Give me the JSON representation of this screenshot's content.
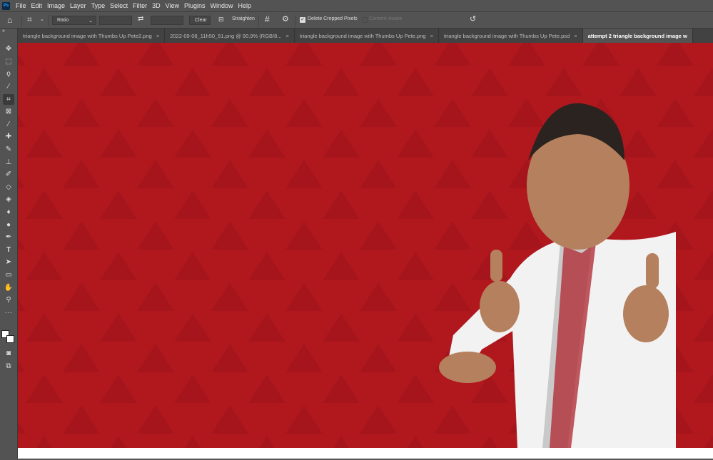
{
  "app": {
    "logo": "Ps"
  },
  "menu": [
    "File",
    "Edit",
    "Image",
    "Layer",
    "Type",
    "Select",
    "Filter",
    "3D",
    "View",
    "Plugins",
    "Window",
    "Help"
  ],
  "options": {
    "ratio": "Ratio",
    "clear": "Clear",
    "straighten": "Straighten",
    "delete_cropped": "Delete Cropped Pixels",
    "delete_cropped_checked": true,
    "content_aware": "Content-Aware",
    "content_aware_checked": false
  },
  "tabs": [
    {
      "label": "triangle background image with Thumbs Up Pete2.png",
      "active": false
    },
    {
      "label": "2022-09-08_11h50_51.png @ 90.9% (RGB/8...",
      "active": false
    },
    {
      "label": "triangle background image with Thumbs Up Pete.png",
      "active": false
    },
    {
      "label": "triangle background image with Thumbs Up Pete.psd",
      "active": false
    },
    {
      "label": "attempt 2 triangle background image w",
      "active": true
    }
  ],
  "tools": [
    "move",
    "marquee",
    "lasso",
    "magic-wand",
    "crop",
    "frame",
    "eyedropper",
    "healing",
    "brush",
    "stamp",
    "history-brush",
    "eraser",
    "paint-bucket",
    "blur",
    "dodge",
    "pen",
    "type",
    "path-select",
    "rectangle",
    "hand",
    "zoom",
    "more"
  ],
  "colors": {
    "canvas_red": "#b0181e",
    "triangle": "#a3151b",
    "foreground": "#ffffff",
    "background": "#ffffff"
  }
}
